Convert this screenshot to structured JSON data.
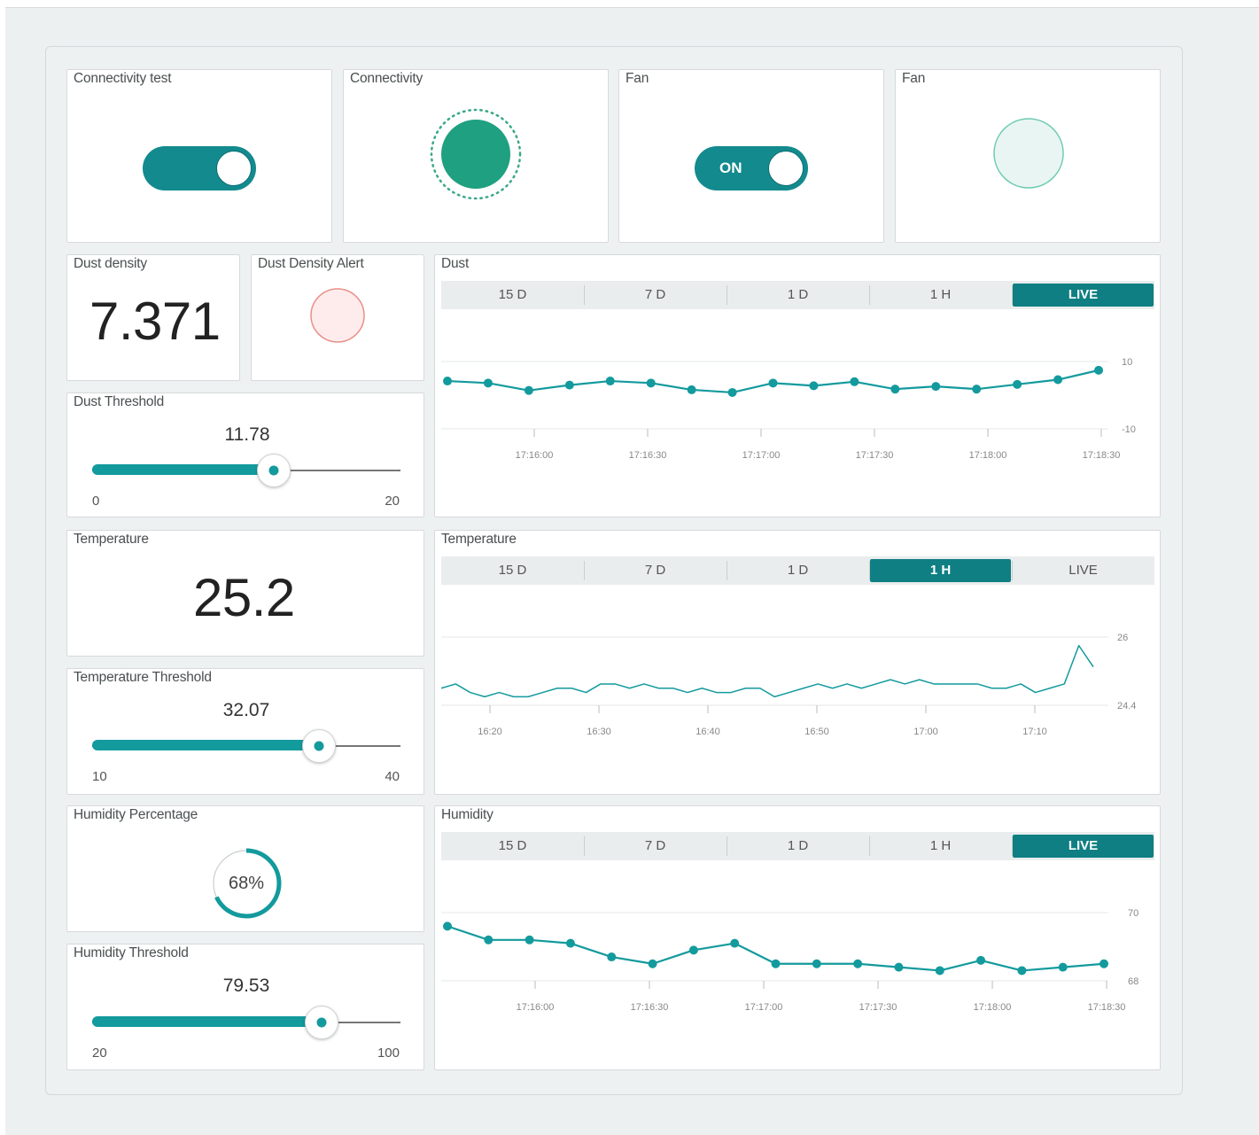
{
  "colors": {
    "accent": "#139a9d",
    "accent_dark": "#0f7f83",
    "alert_fill": "#fdeceb",
    "alert_border": "#e8908a",
    "fan_led_fill": "#e9f5f3",
    "fan_led_border": "#6ccbb1",
    "connect_led": "#1fa080"
  },
  "widgets": {
    "connectivity_test": {
      "title": "Connectivity test",
      "state": "on"
    },
    "connectivity": {
      "title": "Connectivity",
      "state": "on"
    },
    "fan_switch": {
      "title": "Fan",
      "label": "ON",
      "state": "on"
    },
    "fan_led": {
      "title": "Fan",
      "state": "off"
    },
    "dust_density": {
      "title": "Dust density",
      "value": "7.371"
    },
    "dust_alert": {
      "title": "Dust Density Alert",
      "state": "off"
    },
    "dust_threshold": {
      "title": "Dust Threshold",
      "value": "11.78",
      "min": "0",
      "max": "20",
      "fraction": 0.589
    },
    "temperature": {
      "title": "Temperature",
      "value": "25.2"
    },
    "temperature_threshold": {
      "title": "Temperature Threshold",
      "value": "32.07",
      "min": "10",
      "max": "40",
      "fraction": 0.736
    },
    "humidity_percentage": {
      "title": "Humidity Percentage",
      "value": "68%",
      "fraction": 0.68
    },
    "humidity_threshold": {
      "title": "Humidity Threshold",
      "value": "79.53",
      "min": "20",
      "max": "100",
      "fraction": 0.744
    }
  },
  "charts": {
    "tabs": [
      "15 D",
      "7 D",
      "1 D",
      "1 H",
      "LIVE"
    ],
    "dust": {
      "title": "Dust",
      "active_tab": "LIVE"
    },
    "temperature": {
      "title": "Temperature",
      "active_tab": "1 H"
    },
    "humidity": {
      "title": "Humidity",
      "active_tab": "LIVE"
    }
  },
  "chart_data": [
    {
      "type": "line",
      "title": "Dust",
      "x": [
        "17:15:38",
        "17:15:48",
        "17:15:58",
        "17:16:08",
        "17:16:18",
        "17:16:28",
        "17:16:38",
        "17:16:48",
        "17:16:58",
        "17:17:08",
        "17:17:18",
        "17:17:28",
        "17:17:38",
        "17:17:48",
        "17:17:58",
        "17:18:08",
        "17:18:18"
      ],
      "values": [
        4.2,
        3.6,
        1.4,
        3.0,
        4.2,
        3.6,
        1.6,
        0.8,
        3.6,
        2.8,
        4.0,
        1.8,
        2.6,
        1.8,
        3.2,
        4.6,
        7.4
      ],
      "xticks": [
        "17:16:00",
        "17:16:30",
        "17:17:00",
        "17:17:30",
        "17:18:00",
        "17:18:30"
      ],
      "yticks": [
        "10",
        "-10"
      ],
      "ylim": [
        -10,
        10
      ]
    },
    {
      "type": "line",
      "title": "Temperature",
      "x_start": "16:20",
      "x_end": "17:14",
      "values": [
        24.8,
        24.9,
        24.7,
        24.6,
        24.7,
        24.6,
        24.6,
        24.7,
        24.8,
        24.8,
        24.7,
        24.9,
        24.9,
        24.8,
        24.9,
        24.8,
        24.8,
        24.7,
        24.8,
        24.7,
        24.7,
        24.8,
        24.8,
        24.6,
        24.7,
        24.8,
        24.9,
        24.8,
        24.9,
        24.8,
        24.9,
        25.0,
        24.9,
        25.0,
        24.9,
        24.9,
        24.9,
        24.9,
        24.8,
        24.8,
        24.9,
        24.7,
        24.8,
        24.9,
        25.8,
        25.3
      ],
      "xticks": [
        "16:20",
        "16:30",
        "16:40",
        "16:50",
        "17:00",
        "17:10"
      ],
      "yticks": [
        "26",
        "24.4"
      ],
      "ylim": [
        24.4,
        26
      ]
    },
    {
      "type": "line",
      "title": "Humidity",
      "x": [
        "17:15:38",
        "17:15:48",
        "17:15:58",
        "17:16:08",
        "17:16:18",
        "17:16:28",
        "17:16:38",
        "17:16:48",
        "17:16:58",
        "17:17:08",
        "17:17:18",
        "17:17:28",
        "17:17:38",
        "17:17:48",
        "17:17:58",
        "17:18:08",
        "17:18:18"
      ],
      "values": [
        69.6,
        69.2,
        69.2,
        69.1,
        68.7,
        68.5,
        68.9,
        69.1,
        68.5,
        68.5,
        68.5,
        68.4,
        68.3,
        68.6,
        68.3,
        68.4,
        68.5
      ],
      "xticks": [
        "17:16:00",
        "17:16:30",
        "17:17:00",
        "17:17:30",
        "17:18:00",
        "17:18:30"
      ],
      "yticks": [
        "70",
        "68"
      ],
      "ylim": [
        68,
        70
      ]
    }
  ]
}
